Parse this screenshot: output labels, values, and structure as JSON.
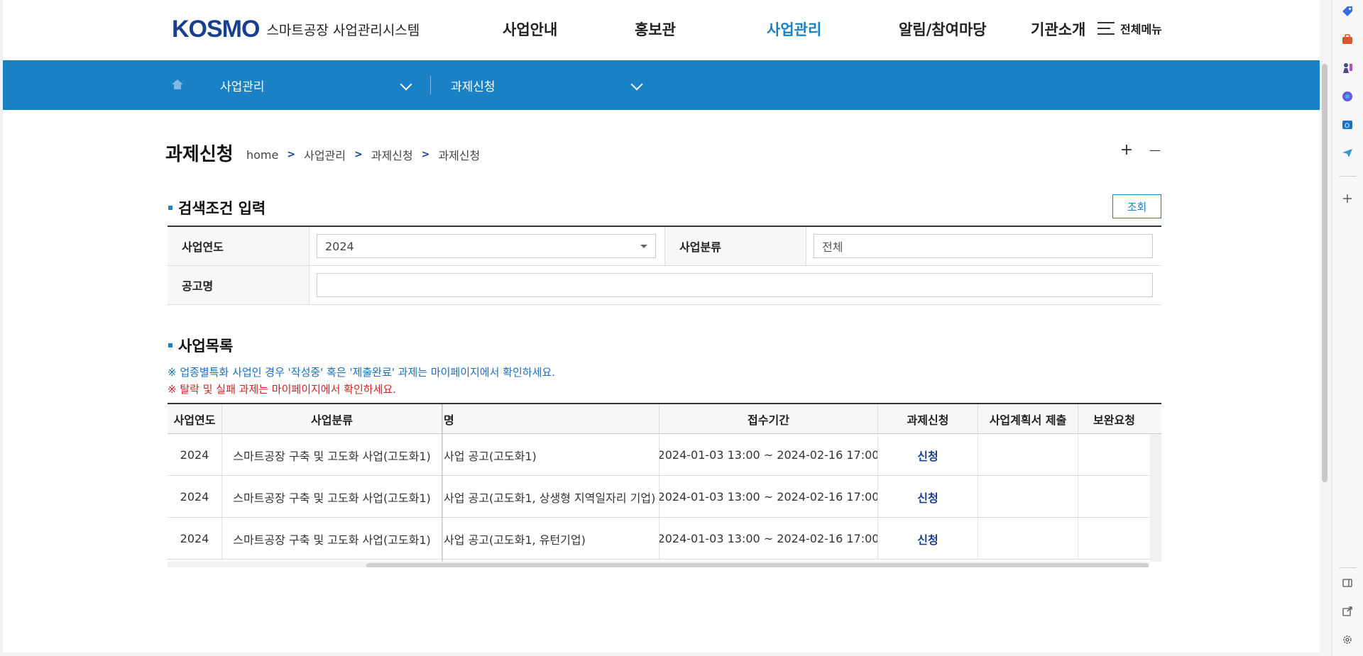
{
  "header": {
    "logo_mark": "KOSMO",
    "logo_text": "스마트공장 사업관리시스템",
    "menu": [
      "사업안내",
      "홍보관",
      "사업관리",
      "알림/참여마당",
      "기관소개"
    ],
    "active_menu": "사업관리",
    "all_menu_label": "전체메뉴"
  },
  "location": {
    "level1": "사업관리",
    "level2": "과제신청"
  },
  "page": {
    "title": "과제신청",
    "breadcrumb": [
      "home",
      "사업관리",
      "과제신청",
      "과제신청"
    ],
    "zoom_in": "+",
    "zoom_out": "—"
  },
  "search": {
    "heading": "검색조건 입력",
    "button": "조회",
    "year_label": "사업연도",
    "year_value": "2024",
    "category_label": "사업분류",
    "category_value": "전체",
    "notice_label": "공고명",
    "notice_value": ""
  },
  "list": {
    "heading": "사업목록",
    "notice_blue": "※ 업종별특화 사업인 경우 '작성중' 혹은 '제출완료' 과제는 마이페이지에서 확인하세요.",
    "notice_red": "※ 탈락 및 실패 과제는 마이페이지에서 확인하세요.",
    "columns": [
      "사업연도",
      "사업분류",
      "명",
      "접수기간",
      "과제신청",
      "사업계획서 제출",
      "보완요청"
    ],
    "rows": [
      {
        "year": "2024",
        "category": "스마트공장 구축 및 고도화 사업(고도화1)",
        "name": "사업 공고(고도화1)",
        "period": "2024-01-03 13:00 ~ 2024-02-16 17:00",
        "apply": "신청",
        "plan": "",
        "supplement": ""
      },
      {
        "year": "2024",
        "category": "스마트공장 구축 및 고도화 사업(고도화1)",
        "name": "사업 공고(고도화1, 상생형 지역일자리 기업)",
        "period": "2024-01-03 13:00 ~ 2024-02-16 17:00",
        "apply": "신청",
        "plan": "",
        "supplement": ""
      },
      {
        "year": "2024",
        "category": "스마트공장 구축 및 고도화 사업(고도화1)",
        "name": "사업 공고(고도화1, 유턴기업)",
        "period": "2024-01-03 13:00 ~ 2024-02-16 17:00",
        "apply": "신청",
        "plan": "",
        "supplement": ""
      }
    ]
  },
  "colors": {
    "primary": "#1a82c4",
    "logo": "#1b3f8f",
    "link": "#1b3f8f",
    "notice_blue": "#1a6fc0",
    "notice_red": "#d42222"
  },
  "sidebar_icons": [
    "tag-icon",
    "briefcase-icon",
    "chess-icon",
    "copilot-icon",
    "outlook-icon",
    "send-icon",
    "add-icon",
    "split-view-icon",
    "external-link-icon",
    "settings-icon"
  ]
}
